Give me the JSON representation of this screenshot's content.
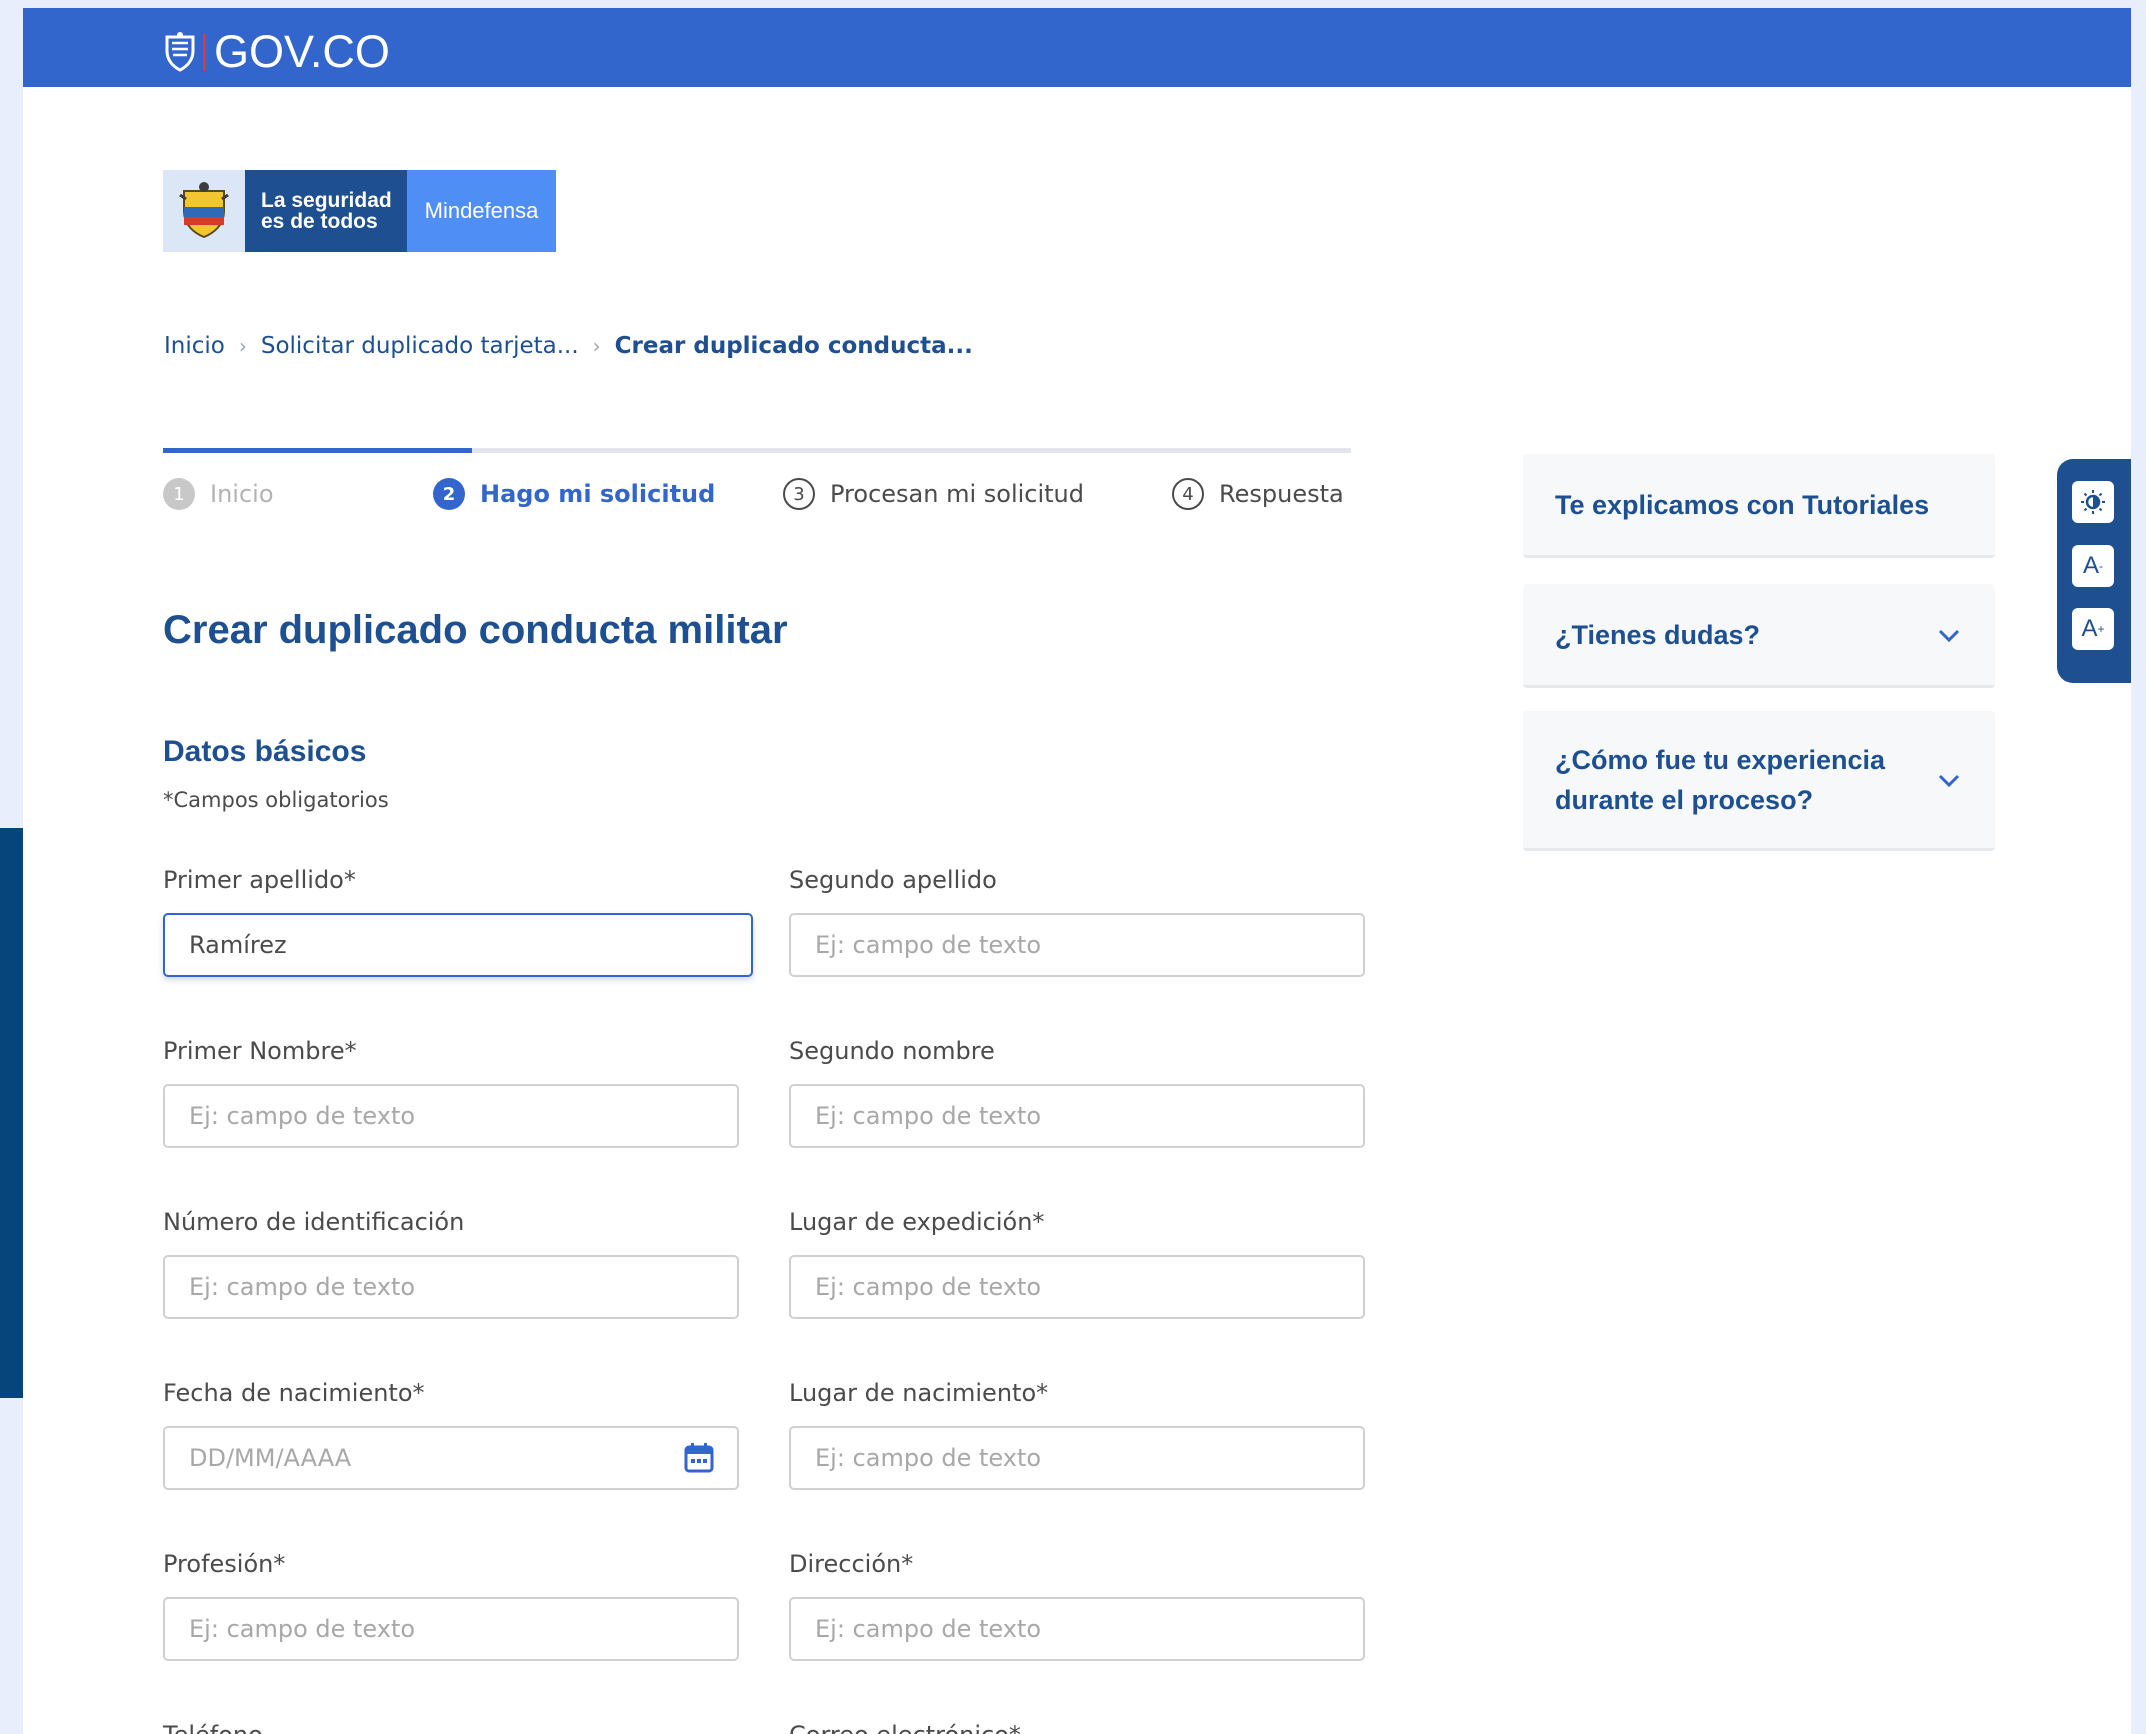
{
  "header": {
    "gov_logo_text": "GOV.CO"
  },
  "entity_logo": {
    "slogan_line1": "La seguridad",
    "slogan_line2": "es de todos",
    "ministry": "Mindefensa"
  },
  "breadcrumb": [
    {
      "label": "Inicio"
    },
    {
      "label": "Solicitar duplicado tarjeta..."
    },
    {
      "label": "Crear duplicado conducta..."
    }
  ],
  "stepper": {
    "progress": 0.26,
    "steps": [
      {
        "number": "1",
        "label": "Inicio",
        "state": "done"
      },
      {
        "number": "2",
        "label": "Hago mi solicitud",
        "state": "active"
      },
      {
        "number": "3",
        "label": "Procesan mi solicitud",
        "state": "pending"
      },
      {
        "number": "4",
        "label": "Respuesta",
        "state": "pending"
      }
    ]
  },
  "form": {
    "title": "Crear duplicado conducta militar",
    "section_title": "Datos básicos",
    "required_note": "*Campos obligatorios",
    "fields": {
      "primer_apellido": {
        "label": "Primer apellido*",
        "value": "Ramírez"
      },
      "segundo_apellido": {
        "label": "Segundo apellido",
        "placeholder": "Ej: campo de texto"
      },
      "primer_nombre": {
        "label": "Primer Nombre*",
        "placeholder": "Ej: campo de texto"
      },
      "segundo_nombre": {
        "label": "Segundo nombre",
        "placeholder": "Ej: campo de texto"
      },
      "numero_identificacion": {
        "label": "Número de identificación",
        "placeholder": "Ej: campo de texto"
      },
      "lugar_expedicion": {
        "label": "Lugar de expedición*",
        "placeholder": "Ej: campo de texto"
      },
      "fecha_nacimiento": {
        "label": "Fecha de nacimiento*",
        "placeholder": "DD/MM/AAAA"
      },
      "lugar_nacimiento": {
        "label": "Lugar de nacimiento*",
        "placeholder": "Ej: campo de texto"
      },
      "profesion": {
        "label": "Profesión*",
        "placeholder": "Ej: campo de texto"
      },
      "direccion": {
        "label": "Dirección*",
        "placeholder": "Ej: campo de texto"
      },
      "telefono": {
        "label": "Teléfono"
      },
      "correo": {
        "label": "Correo electrónico*"
      }
    }
  },
  "sidebar": {
    "tutorials": "Te explicamos con Tutoriales",
    "doubts": "¿Tienes dudas?",
    "experience": "¿Cómo fue tu experiencia durante el proceso?"
  },
  "accessibility": {
    "contrast_icon": "contrast-icon",
    "decrease_label": "A",
    "decrease_sup": "-",
    "increase_label": "A",
    "increase_sup": "+"
  },
  "colors": {
    "gov_blue": "#3366cc",
    "navy": "#1d4f91",
    "ministry_blue": "#4f8ef5",
    "background": "#e8eefb"
  }
}
